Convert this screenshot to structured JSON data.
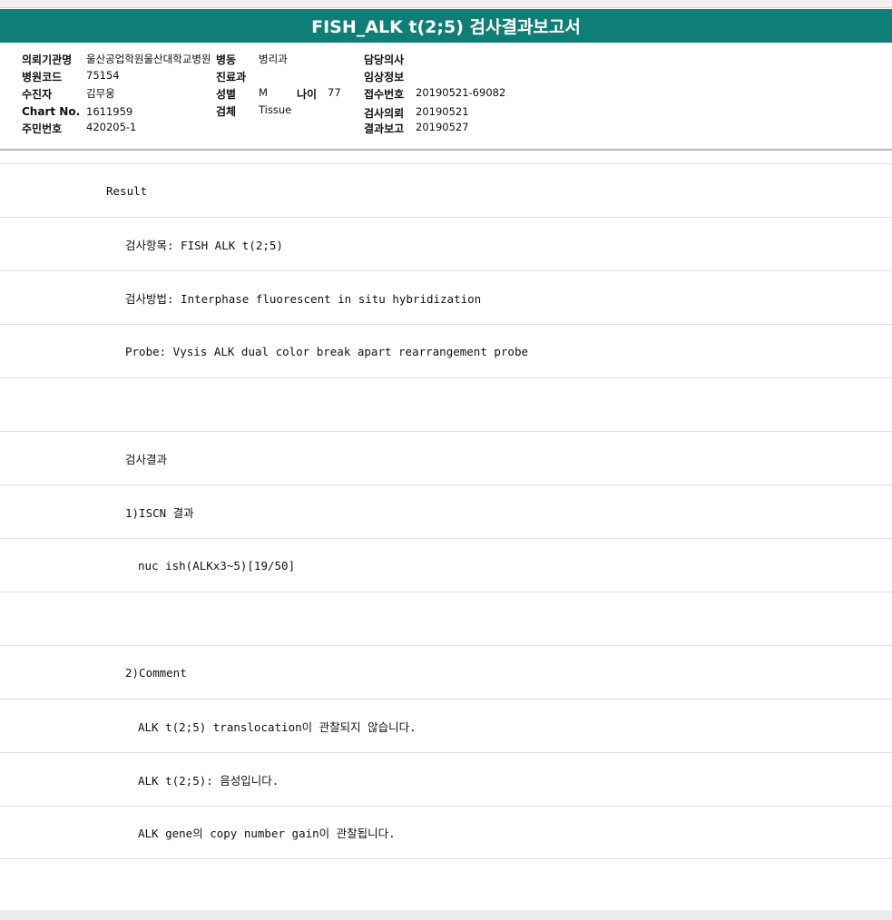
{
  "title": "FISH_ALK t(2;5) 검사결과보고서",
  "header": {
    "col1": [
      {
        "label": "의뢰기관명",
        "value": "울산공업학원울산대학교병원"
      },
      {
        "label": "병원코드",
        "value": "75154"
      },
      {
        "label": "수진자",
        "value": "김무웅"
      },
      {
        "label": "Chart No.",
        "value": "1611959"
      },
      {
        "label": "주민번호",
        "value": "420205-1"
      }
    ],
    "col2": [
      {
        "label": "병동",
        "value": "병리과"
      },
      {
        "label": "진료과",
        "value": ""
      },
      {
        "label": "성별",
        "value": "M"
      },
      {
        "label": "검체",
        "value": "Tissue"
      }
    ],
    "age": {
      "label": "나이",
      "value": "77"
    },
    "col3": [
      {
        "label": "담당의사",
        "value": ""
      },
      {
        "label": "임상정보",
        "value": ""
      },
      {
        "label": "접수번호",
        "value": "20190521-69082"
      },
      {
        "label": "검사의뢰",
        "value": "20190521"
      },
      {
        "label": "결과보고",
        "value": "20190527"
      }
    ]
  },
  "rows": [
    {
      "text": "Result",
      "indent": 117
    },
    {
      "text": "검사항목: FISH ALK t(2;5)",
      "indent": 138
    },
    {
      "text": "검사방법: Interphase fluorescent in situ hybridization",
      "indent": 138
    },
    {
      "text": "Probe: Vysis ALK dual color break apart rearrangement probe",
      "indent": 138
    },
    {
      "text": "",
      "indent": 138
    },
    {
      "text": "검사결과",
      "indent": 138
    },
    {
      "text": "1)ISCN 결과",
      "indent": 138
    },
    {
      "text": "nuc ish(ALKx3~5)[19/50]",
      "indent": 152
    },
    {
      "text": "",
      "indent": 138
    },
    {
      "text": "2)Comment",
      "indent": 138
    },
    {
      "text": "ALK t(2;5) translocation이 관찰되지 않습니다.",
      "indent": 152
    },
    {
      "text": "ALK t(2;5): 음성입니다.",
      "indent": 152
    },
    {
      "text": "ALK gene의 copy number gain이 관찰됩니다.",
      "indent": 152
    }
  ]
}
